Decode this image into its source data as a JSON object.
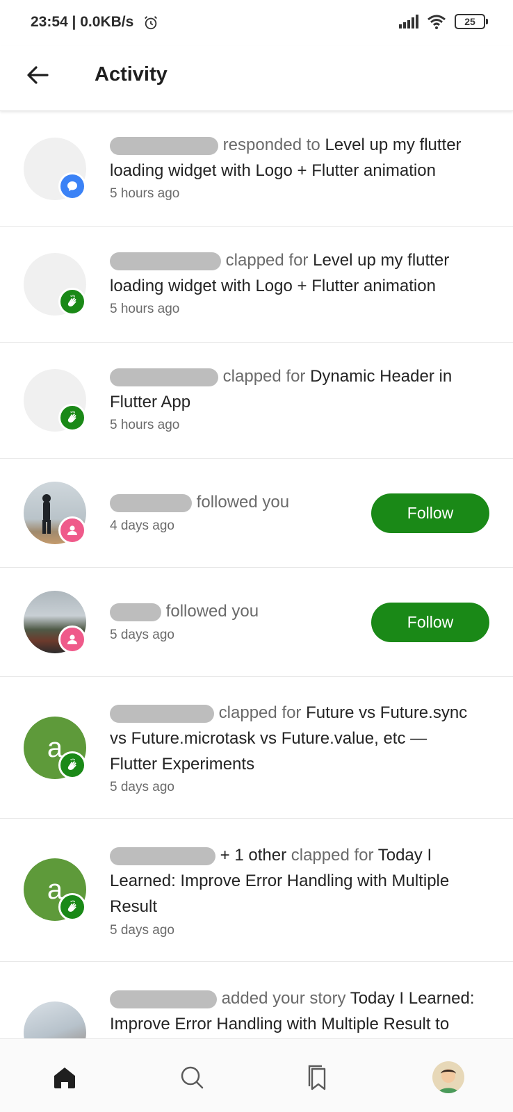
{
  "status": {
    "time": "23:54 | 0.0KB/s",
    "battery": "25"
  },
  "header": {
    "title": "Activity"
  },
  "items": [
    {
      "action": "responded to",
      "title_line1": "Level up my flutter",
      "title_line2": "loading widget with Logo + Flutter animation",
      "time": "5 hours ago"
    },
    {
      "action": "clapped for",
      "title_line1": "Level up my flutter",
      "title_line2": "loading widget with Logo + Flutter animation",
      "time": "5 hours ago"
    },
    {
      "action": "clapped for",
      "title_line1": "Dynamic Header in",
      "title_line2": "Flutter App",
      "time": "5 hours ago"
    },
    {
      "action": "followed you",
      "time": "4 days ago",
      "button": "Follow"
    },
    {
      "action": "followed you",
      "time": "5 days ago",
      "button": "Follow"
    },
    {
      "avatar_letter": "a",
      "action": "clapped for",
      "title_line1": "Future vs Future.sync",
      "title_line2": "vs Future.microtask vs Future.value, etc —",
      "title_line3": "Flutter Experiments",
      "time": "5 days ago"
    },
    {
      "avatar_letter": "a",
      "extra": "+ 1 other",
      "action": "clapped for",
      "title_line1": "Today I",
      "title_line2": "Learned: Improve Error Handling with Multiple",
      "title_line3": "Result",
      "time": "5 days ago"
    },
    {
      "action": "added your story",
      "title_line1": "Today I Learned:",
      "title_line2": "Improve Error Handling with Multiple Result to"
    }
  ],
  "nav": {
    "icons": [
      "home-icon",
      "search-icon",
      "bookmarks-icon",
      "profile-avatar"
    ],
    "accent": "#1a8917"
  }
}
